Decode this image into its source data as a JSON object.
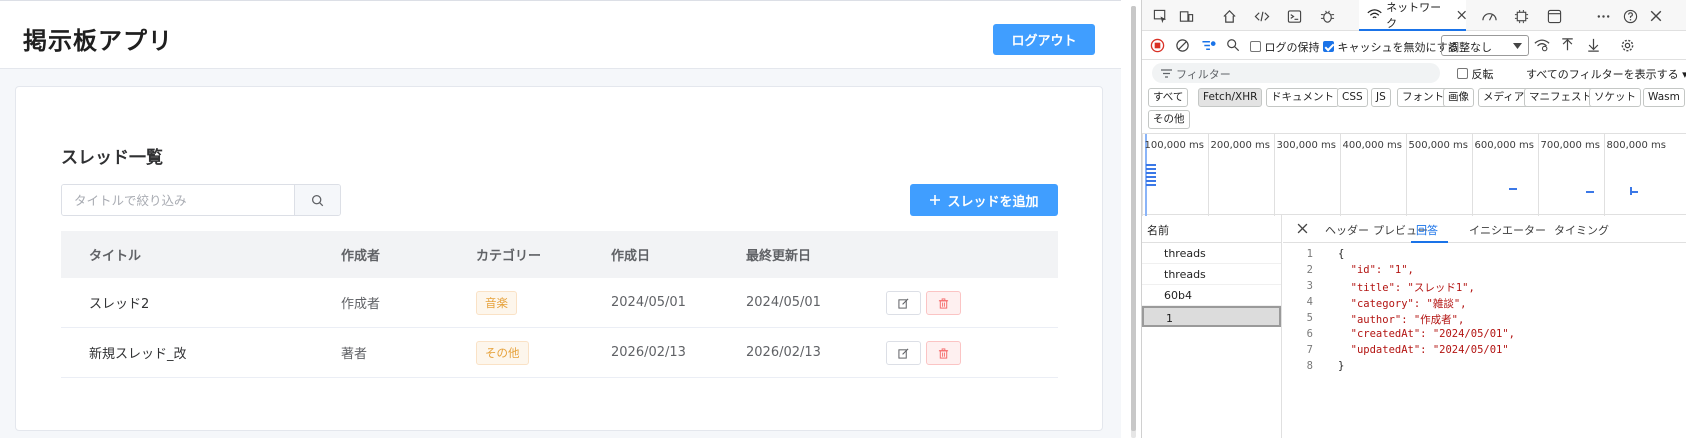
{
  "app": {
    "title": "掲示板アプリ",
    "logout_label": "ログアウト",
    "section_title": "スレッド一覧",
    "search_placeholder": "タイトルで絞り込み",
    "add_label": "スレッドを追加",
    "add_icon": "plus-icon",
    "table": {
      "headers": [
        "タイトル",
        "作成者",
        "カテゴリー",
        "作成日",
        "最終更新日"
      ],
      "rows": [
        {
          "title": "スレッド2",
          "author": "作成者",
          "category": "音楽",
          "created": "2024/05/01",
          "updated": "2024/05/01"
        },
        {
          "title": "新規スレッド_改",
          "author": "著者",
          "category": "その他",
          "created": "2026/02/13",
          "updated": "2026/02/13"
        }
      ]
    },
    "colors": {
      "primary": "#409eff",
      "danger": "#f56c6c",
      "warning": "#e6a23c"
    }
  },
  "devtools": {
    "network_tab_label": "ネットワーク",
    "preserve_log_label": "ログの保持",
    "disable_cache_label": "キャッシュを無効にする",
    "throttle_value": "調整なし",
    "filter_placeholder": "フィルター",
    "invert_label": "反転",
    "show_all_filters_label": "すべてのフィルターを表示する",
    "chips": [
      "すべて",
      "Fetch/XHR",
      "ドキュメント",
      "CSS",
      "JS",
      "フォント",
      "画像",
      "メディア",
      "マニフェスト",
      "ソケット",
      "Wasm",
      "その他"
    ],
    "active_chip": "Fetch/XHR",
    "timeline_labels": [
      "100,000 ms",
      "200,000 ms",
      "300,000 ms",
      "400,000 ms",
      "500,000 ms",
      "600,000 ms",
      "700,000 ms",
      "800,000 ms"
    ],
    "names_header": "名前",
    "requests": [
      "threads",
      "threads",
      "60b4",
      "1"
    ],
    "selected_request": "1",
    "detail_tabs": [
      "ヘッダー",
      "プレビュー",
      "回答",
      "イニシエーター",
      "タイミング"
    ],
    "active_detail_tab": "回答",
    "response_lines": [
      "{",
      "  \"id\": \"1\",",
      "  \"title\": \"スレッド1\",",
      "  \"category\": \"雑談\",",
      "  \"author\": \"作成者\",",
      "  \"createdAt\": \"2024/05/01\",",
      "  \"updatedAt\": \"2024/05/01\"",
      "}"
    ],
    "line_numbers": [
      "1",
      "2",
      "3",
      "4",
      "5",
      "6",
      "7",
      "8"
    ]
  }
}
